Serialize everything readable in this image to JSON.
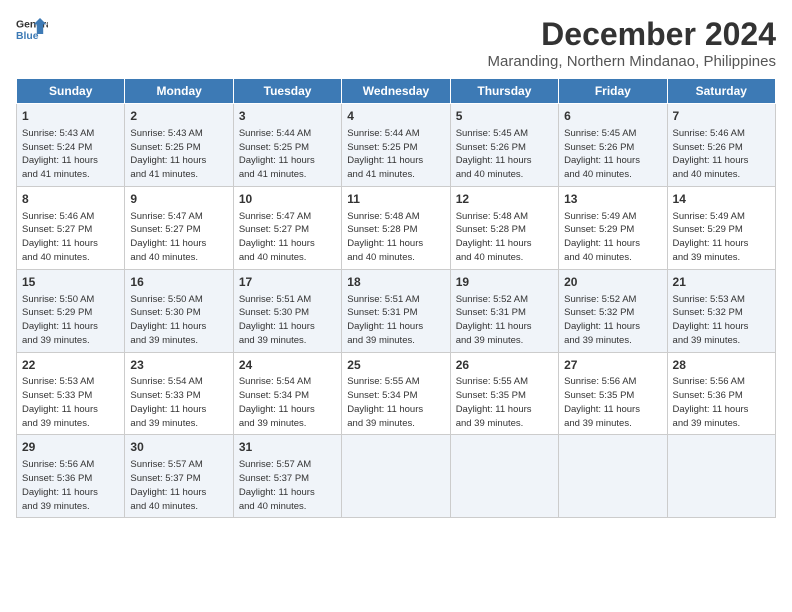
{
  "header": {
    "logo_line1": "General",
    "logo_line2": "Blue",
    "month": "December 2024",
    "location": "Maranding, Northern Mindanao, Philippines"
  },
  "days_of_week": [
    "Sunday",
    "Monday",
    "Tuesday",
    "Wednesday",
    "Thursday",
    "Friday",
    "Saturday"
  ],
  "weeks": [
    [
      {
        "day": "1",
        "info": "Sunrise: 5:43 AM\nSunset: 5:24 PM\nDaylight: 11 hours\nand 41 minutes."
      },
      {
        "day": "2",
        "info": "Sunrise: 5:43 AM\nSunset: 5:25 PM\nDaylight: 11 hours\nand 41 minutes."
      },
      {
        "day": "3",
        "info": "Sunrise: 5:44 AM\nSunset: 5:25 PM\nDaylight: 11 hours\nand 41 minutes."
      },
      {
        "day": "4",
        "info": "Sunrise: 5:44 AM\nSunset: 5:25 PM\nDaylight: 11 hours\nand 41 minutes."
      },
      {
        "day": "5",
        "info": "Sunrise: 5:45 AM\nSunset: 5:26 PM\nDaylight: 11 hours\nand 40 minutes."
      },
      {
        "day": "6",
        "info": "Sunrise: 5:45 AM\nSunset: 5:26 PM\nDaylight: 11 hours\nand 40 minutes."
      },
      {
        "day": "7",
        "info": "Sunrise: 5:46 AM\nSunset: 5:26 PM\nDaylight: 11 hours\nand 40 minutes."
      }
    ],
    [
      {
        "day": "8",
        "info": "Sunrise: 5:46 AM\nSunset: 5:27 PM\nDaylight: 11 hours\nand 40 minutes."
      },
      {
        "day": "9",
        "info": "Sunrise: 5:47 AM\nSunset: 5:27 PM\nDaylight: 11 hours\nand 40 minutes."
      },
      {
        "day": "10",
        "info": "Sunrise: 5:47 AM\nSunset: 5:27 PM\nDaylight: 11 hours\nand 40 minutes."
      },
      {
        "day": "11",
        "info": "Sunrise: 5:48 AM\nSunset: 5:28 PM\nDaylight: 11 hours\nand 40 minutes."
      },
      {
        "day": "12",
        "info": "Sunrise: 5:48 AM\nSunset: 5:28 PM\nDaylight: 11 hours\nand 40 minutes."
      },
      {
        "day": "13",
        "info": "Sunrise: 5:49 AM\nSunset: 5:29 PM\nDaylight: 11 hours\nand 40 minutes."
      },
      {
        "day": "14",
        "info": "Sunrise: 5:49 AM\nSunset: 5:29 PM\nDaylight: 11 hours\nand 39 minutes."
      }
    ],
    [
      {
        "day": "15",
        "info": "Sunrise: 5:50 AM\nSunset: 5:29 PM\nDaylight: 11 hours\nand 39 minutes."
      },
      {
        "day": "16",
        "info": "Sunrise: 5:50 AM\nSunset: 5:30 PM\nDaylight: 11 hours\nand 39 minutes."
      },
      {
        "day": "17",
        "info": "Sunrise: 5:51 AM\nSunset: 5:30 PM\nDaylight: 11 hours\nand 39 minutes."
      },
      {
        "day": "18",
        "info": "Sunrise: 5:51 AM\nSunset: 5:31 PM\nDaylight: 11 hours\nand 39 minutes."
      },
      {
        "day": "19",
        "info": "Sunrise: 5:52 AM\nSunset: 5:31 PM\nDaylight: 11 hours\nand 39 minutes."
      },
      {
        "day": "20",
        "info": "Sunrise: 5:52 AM\nSunset: 5:32 PM\nDaylight: 11 hours\nand 39 minutes."
      },
      {
        "day": "21",
        "info": "Sunrise: 5:53 AM\nSunset: 5:32 PM\nDaylight: 11 hours\nand 39 minutes."
      }
    ],
    [
      {
        "day": "22",
        "info": "Sunrise: 5:53 AM\nSunset: 5:33 PM\nDaylight: 11 hours\nand 39 minutes."
      },
      {
        "day": "23",
        "info": "Sunrise: 5:54 AM\nSunset: 5:33 PM\nDaylight: 11 hours\nand 39 minutes."
      },
      {
        "day": "24",
        "info": "Sunrise: 5:54 AM\nSunset: 5:34 PM\nDaylight: 11 hours\nand 39 minutes."
      },
      {
        "day": "25",
        "info": "Sunrise: 5:55 AM\nSunset: 5:34 PM\nDaylight: 11 hours\nand 39 minutes."
      },
      {
        "day": "26",
        "info": "Sunrise: 5:55 AM\nSunset: 5:35 PM\nDaylight: 11 hours\nand 39 minutes."
      },
      {
        "day": "27",
        "info": "Sunrise: 5:56 AM\nSunset: 5:35 PM\nDaylight: 11 hours\nand 39 minutes."
      },
      {
        "day": "28",
        "info": "Sunrise: 5:56 AM\nSunset: 5:36 PM\nDaylight: 11 hours\nand 39 minutes."
      }
    ],
    [
      {
        "day": "29",
        "info": "Sunrise: 5:56 AM\nSunset: 5:36 PM\nDaylight: 11 hours\nand 39 minutes."
      },
      {
        "day": "30",
        "info": "Sunrise: 5:57 AM\nSunset: 5:37 PM\nDaylight: 11 hours\nand 40 minutes."
      },
      {
        "day": "31",
        "info": "Sunrise: 5:57 AM\nSunset: 5:37 PM\nDaylight: 11 hours\nand 40 minutes."
      },
      {
        "day": "",
        "info": ""
      },
      {
        "day": "",
        "info": ""
      },
      {
        "day": "",
        "info": ""
      },
      {
        "day": "",
        "info": ""
      }
    ]
  ]
}
